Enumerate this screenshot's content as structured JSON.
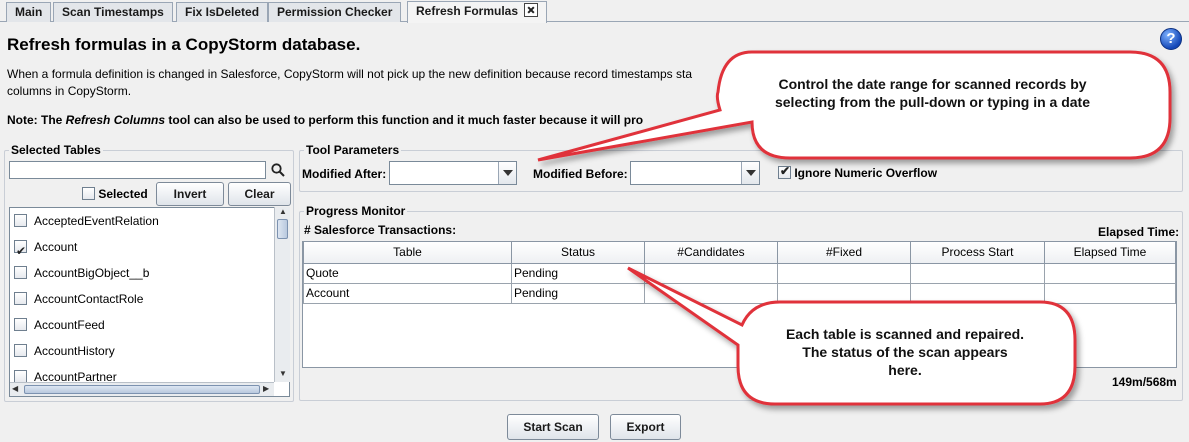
{
  "tabs": [
    {
      "label": "Main"
    },
    {
      "label": "Scan Timestamps"
    },
    {
      "label": "Fix IsDeleted"
    },
    {
      "label": "Permission Checker"
    },
    {
      "label": "Refresh Formulas"
    }
  ],
  "header": {
    "title": "Refresh formulas in a CopyStorm database.",
    "description": "When a formula definition is changed in Salesforce, CopyStorm will not pick up the new definition because record timestamps sta columns in CopyStorm.",
    "description_line1": "When a formula definition is changed in Salesforce, CopyStorm will not pick up the new definition because record timestamps sta",
    "description_line2": "columns in CopyStorm.",
    "note_prefix": "Note: The ",
    "note_tool": "Refresh Columns",
    "note_suffix": " tool can also be used to perform this function and it much faster because it will pro",
    "help_label": "?"
  },
  "selected_tables": {
    "title": "Selected Tables",
    "search_value": "",
    "selected_label": "Selected",
    "invert_label": "Invert",
    "clear_label": "Clear",
    "items": [
      {
        "label": "AcceptedEventRelation",
        "checked": false
      },
      {
        "label": "Account",
        "checked": true
      },
      {
        "label": "AccountBigObject__b",
        "checked": false
      },
      {
        "label": "AccountContactRole",
        "checked": false
      },
      {
        "label": "AccountFeed",
        "checked": false
      },
      {
        "label": "AccountHistory",
        "checked": false
      },
      {
        "label": "AccountPartner",
        "checked": false
      }
    ]
  },
  "tool_parameters": {
    "title": "Tool Parameters",
    "modified_after_label": "Modified After:",
    "modified_after_value": "",
    "modified_before_label": "Modified Before:",
    "modified_before_value": "",
    "ignore_overflow_label": "Ignore Numeric Overflow",
    "ignore_overflow_checked": true
  },
  "progress_monitor": {
    "title": "Progress Monitor",
    "transactions_label": "# Salesforce Transactions:",
    "elapsed_label": "Elapsed Time:",
    "columns": [
      "Table",
      "Status",
      "#Candidates",
      "#Fixed",
      "Process Start",
      "Elapsed Time"
    ],
    "rows": [
      [
        "Quote",
        "Pending",
        "",
        "",
        "",
        ""
      ],
      [
        "Account",
        "Pending",
        "",
        "",
        "",
        ""
      ]
    ],
    "memory": "149m/568m"
  },
  "actions": {
    "start_label": "Start Scan",
    "export_label": "Export"
  },
  "callouts": {
    "date_range": "Control the date range for scanned records by selecting from the pull-down or typing in a date",
    "status": "Each table is scanned and repaired. The status of the scan appears here."
  },
  "colors": {
    "callout_border": "#e0333a",
    "help_icon": "#1448b8"
  }
}
